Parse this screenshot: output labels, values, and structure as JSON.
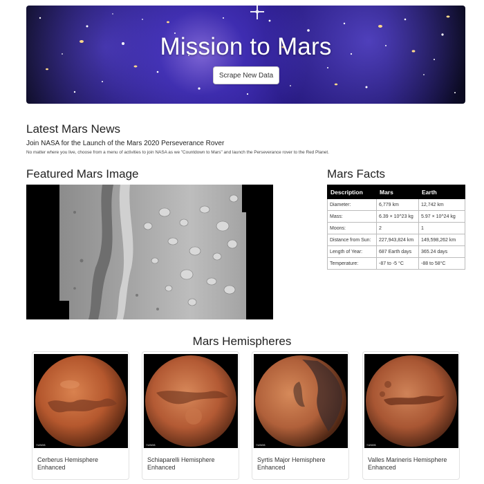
{
  "hero": {
    "title": "Mission to Mars",
    "button_label": "Scrape New Data"
  },
  "news": {
    "heading": "Latest Mars News",
    "title": "Join NASA for the Launch of the Mars 2020 Perseverance Rover",
    "teaser": "No matter where you live, choose from a menu of activities to join NASA as we \"Countdown to Mars\" and launch the Perseverance rover to the Red Planet."
  },
  "featured": {
    "heading": "Featured Mars Image"
  },
  "facts": {
    "heading": "Mars Facts",
    "columns": [
      "Description",
      "Mars",
      "Earth"
    ],
    "rows": [
      [
        "Diameter:",
        "6,779 km",
        "12,742 km"
      ],
      [
        "Mass:",
        "6.39 × 10^23 kg",
        "5.97 × 10^24 kg"
      ],
      [
        "Moons:",
        "2",
        "1"
      ],
      [
        "Distance from Sun:",
        "227,943,824 km",
        "149,598,262 km"
      ],
      [
        "Length of Year:",
        "687 Earth days",
        "365.24 days"
      ],
      [
        "Temperature:",
        "-87 to -5 °C",
        "-88 to 58°C"
      ]
    ]
  },
  "hemispheres": {
    "heading": "Mars Hemispheres",
    "items": [
      {
        "title": "Cerberus Hemisphere Enhanced"
      },
      {
        "title": "Schiaparelli Hemisphere Enhanced"
      },
      {
        "title": "Syrtis Major Hemisphere Enhanced"
      },
      {
        "title": "Valles Marineris Hemisphere Enhanced"
      }
    ]
  },
  "colors": {
    "hero_background": "#2a1b8a",
    "table_header": "#000000",
    "mars_surface": "#b5582e"
  }
}
